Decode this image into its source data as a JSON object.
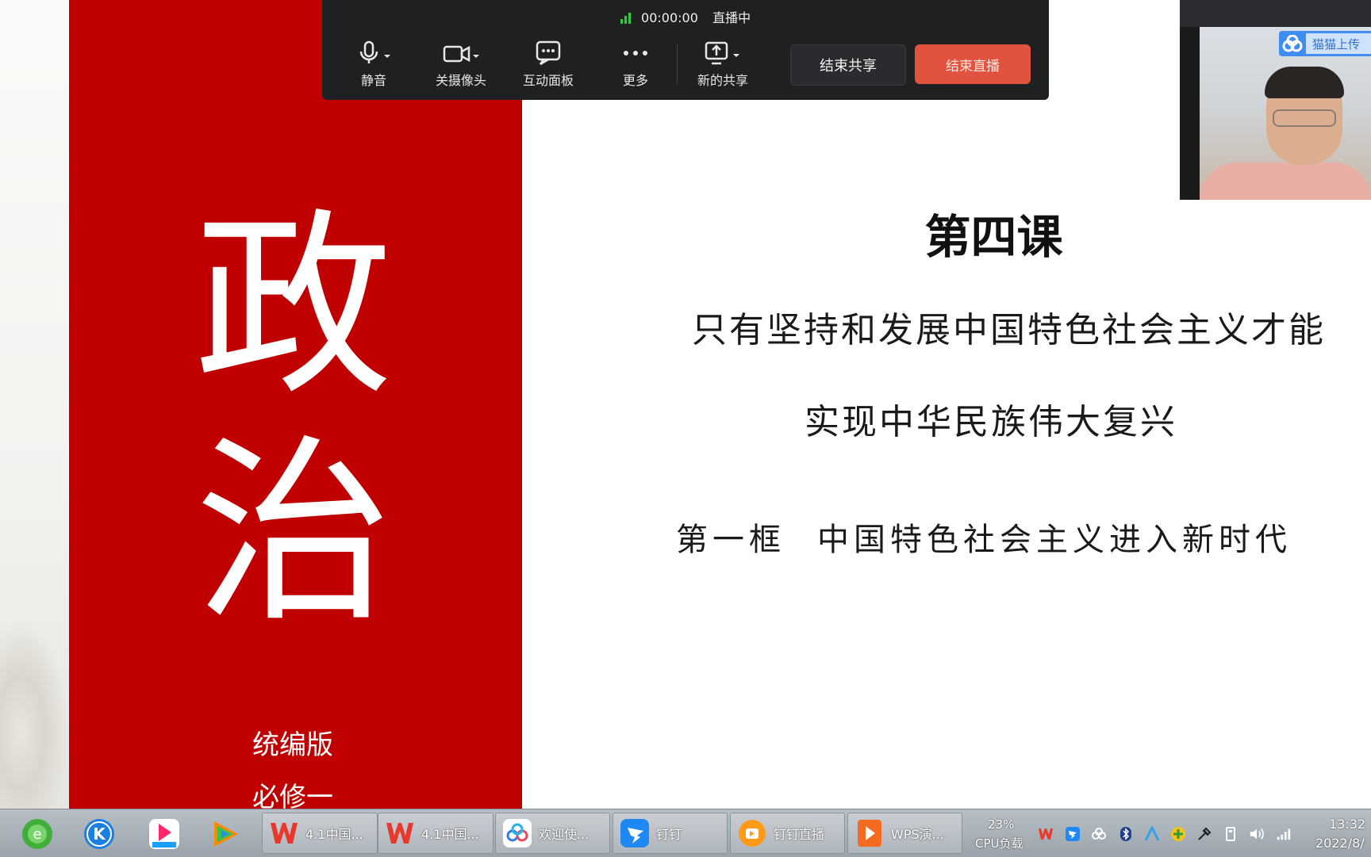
{
  "slide": {
    "big_chars": [
      "政",
      "治"
    ],
    "edition": [
      "统编版",
      "必修一"
    ],
    "lesson_title": "第四课",
    "subtitle_line1": "只有坚持和发展中国特色社会主义才能",
    "subtitle_line2": "实现中华民族伟大复兴",
    "section_label": "第一框",
    "section_title": "中国特色社会主义进入新时代",
    "accent_color": "#c00000"
  },
  "live_bar": {
    "timer": "00:00:00",
    "status": "直播中",
    "tools": [
      {
        "label": "静音",
        "icon": "microphone-icon"
      },
      {
        "label": "关摄像头",
        "icon": "camera-icon"
      },
      {
        "label": "互动面板",
        "icon": "chat-panel-icon"
      },
      {
        "label": "更多",
        "icon": "more-icon"
      },
      {
        "label": "新的共享",
        "icon": "share-screen-icon"
      }
    ],
    "end_share_label": "结束共享",
    "end_live_label": "结束直播",
    "end_live_color": "#e2533f"
  },
  "camera": {
    "badge_text": "猫猫上传"
  },
  "taskbar": {
    "apps": [
      {
        "label": "4.1中国...",
        "icon": "wps-writer-icon"
      },
      {
        "label": "4.1中国...",
        "icon": "wps-writer-icon"
      },
      {
        "label": "欢迎使...",
        "icon": "baidu-netdisk-icon"
      },
      {
        "label": "钉钉",
        "icon": "dingtalk-icon"
      },
      {
        "label": "钉钉直播",
        "icon": "dingtalk-live-icon"
      },
      {
        "label": "WPS演...",
        "icon": "wps-presentation-icon"
      }
    ],
    "cpu_percent": "23%",
    "cpu_label": "CPU负载",
    "time": "13:32",
    "date": "2022/8/"
  }
}
